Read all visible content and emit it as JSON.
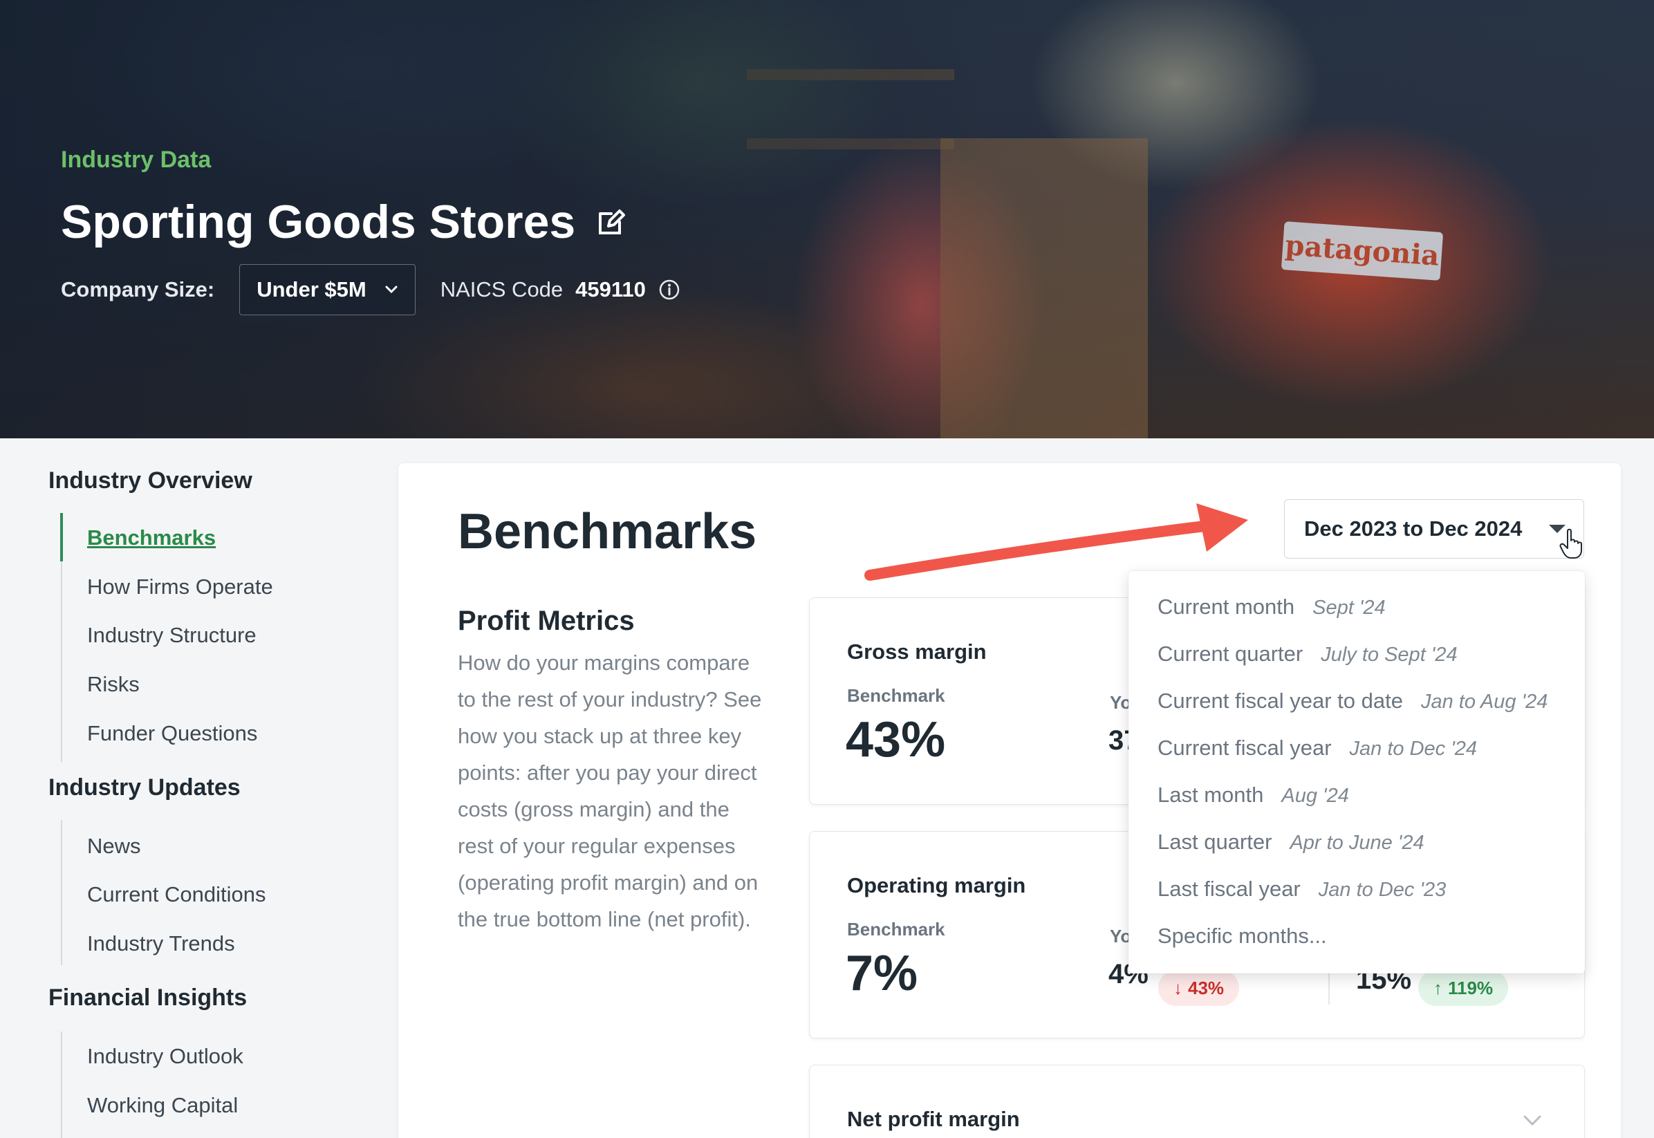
{
  "header": {
    "eyebrow": "Industry Data",
    "title": "Sporting Goods Stores",
    "company_size_label": "Company Size:",
    "company_size_value": "Under $5M",
    "naics_label": "NAICS Code",
    "naics_value": "459110",
    "hero_logo_text": "patagonia"
  },
  "sidebar": {
    "sections": [
      {
        "title": "Industry Overview",
        "items": [
          "Benchmarks",
          "How Firms Operate",
          "Industry Structure",
          "Risks",
          "Funder Questions"
        ]
      },
      {
        "title": "Industry Updates",
        "items": [
          "News",
          "Current Conditions",
          "Industry Trends"
        ]
      },
      {
        "title": "Financial Insights",
        "items": [
          "Industry Outlook",
          "Working Capital"
        ]
      }
    ],
    "active_item": "Benchmarks"
  },
  "main": {
    "title": "Benchmarks",
    "date_range": "Dec 2023 to Dec 2024",
    "section_title": "Profit Metrics",
    "section_description": "How do your margins compare to the rest of your industry? See how you stack up at three key points: after you pay your direct costs (gross margin) and the rest of your regular expenses (operating profit margin) and on the true bottom line (net profit).",
    "metrics": [
      {
        "name": "Gross margin",
        "benchmark_label": "Benchmark",
        "benchmark_value": "43%",
        "your_label": "Yo",
        "your_value": "37"
      },
      {
        "name": "Operating margin",
        "benchmark_label": "Benchmark",
        "benchmark_value": "7%",
        "your_label": "Yo",
        "your_value": "4%",
        "your_change": "43%",
        "other_value": "15%",
        "other_change": "119%"
      },
      {
        "name": "Net profit margin"
      }
    ]
  },
  "date_dropdown": {
    "options": [
      {
        "label": "Current month",
        "hint": "Sept '24"
      },
      {
        "label": "Current quarter",
        "hint": "July to Sept '24"
      },
      {
        "label": "Current fiscal year to date",
        "hint": "Jan to Aug '24"
      },
      {
        "label": "Current fiscal year",
        "hint": "Jan to Dec '24"
      },
      {
        "label": "Last month",
        "hint": "Aug '24"
      },
      {
        "label": "Last quarter",
        "hint": "Apr to June '24"
      },
      {
        "label": "Last fiscal year",
        "hint": "Jan to Dec '23"
      },
      {
        "label": "Specific months...",
        "hint": ""
      }
    ]
  },
  "colors": {
    "accent_green": "#6cc06a",
    "active_link": "#2a8a4a",
    "annotation_arrow": "#f0574a",
    "down_pill": "#c8302a",
    "up_pill": "#2a8a4a"
  }
}
